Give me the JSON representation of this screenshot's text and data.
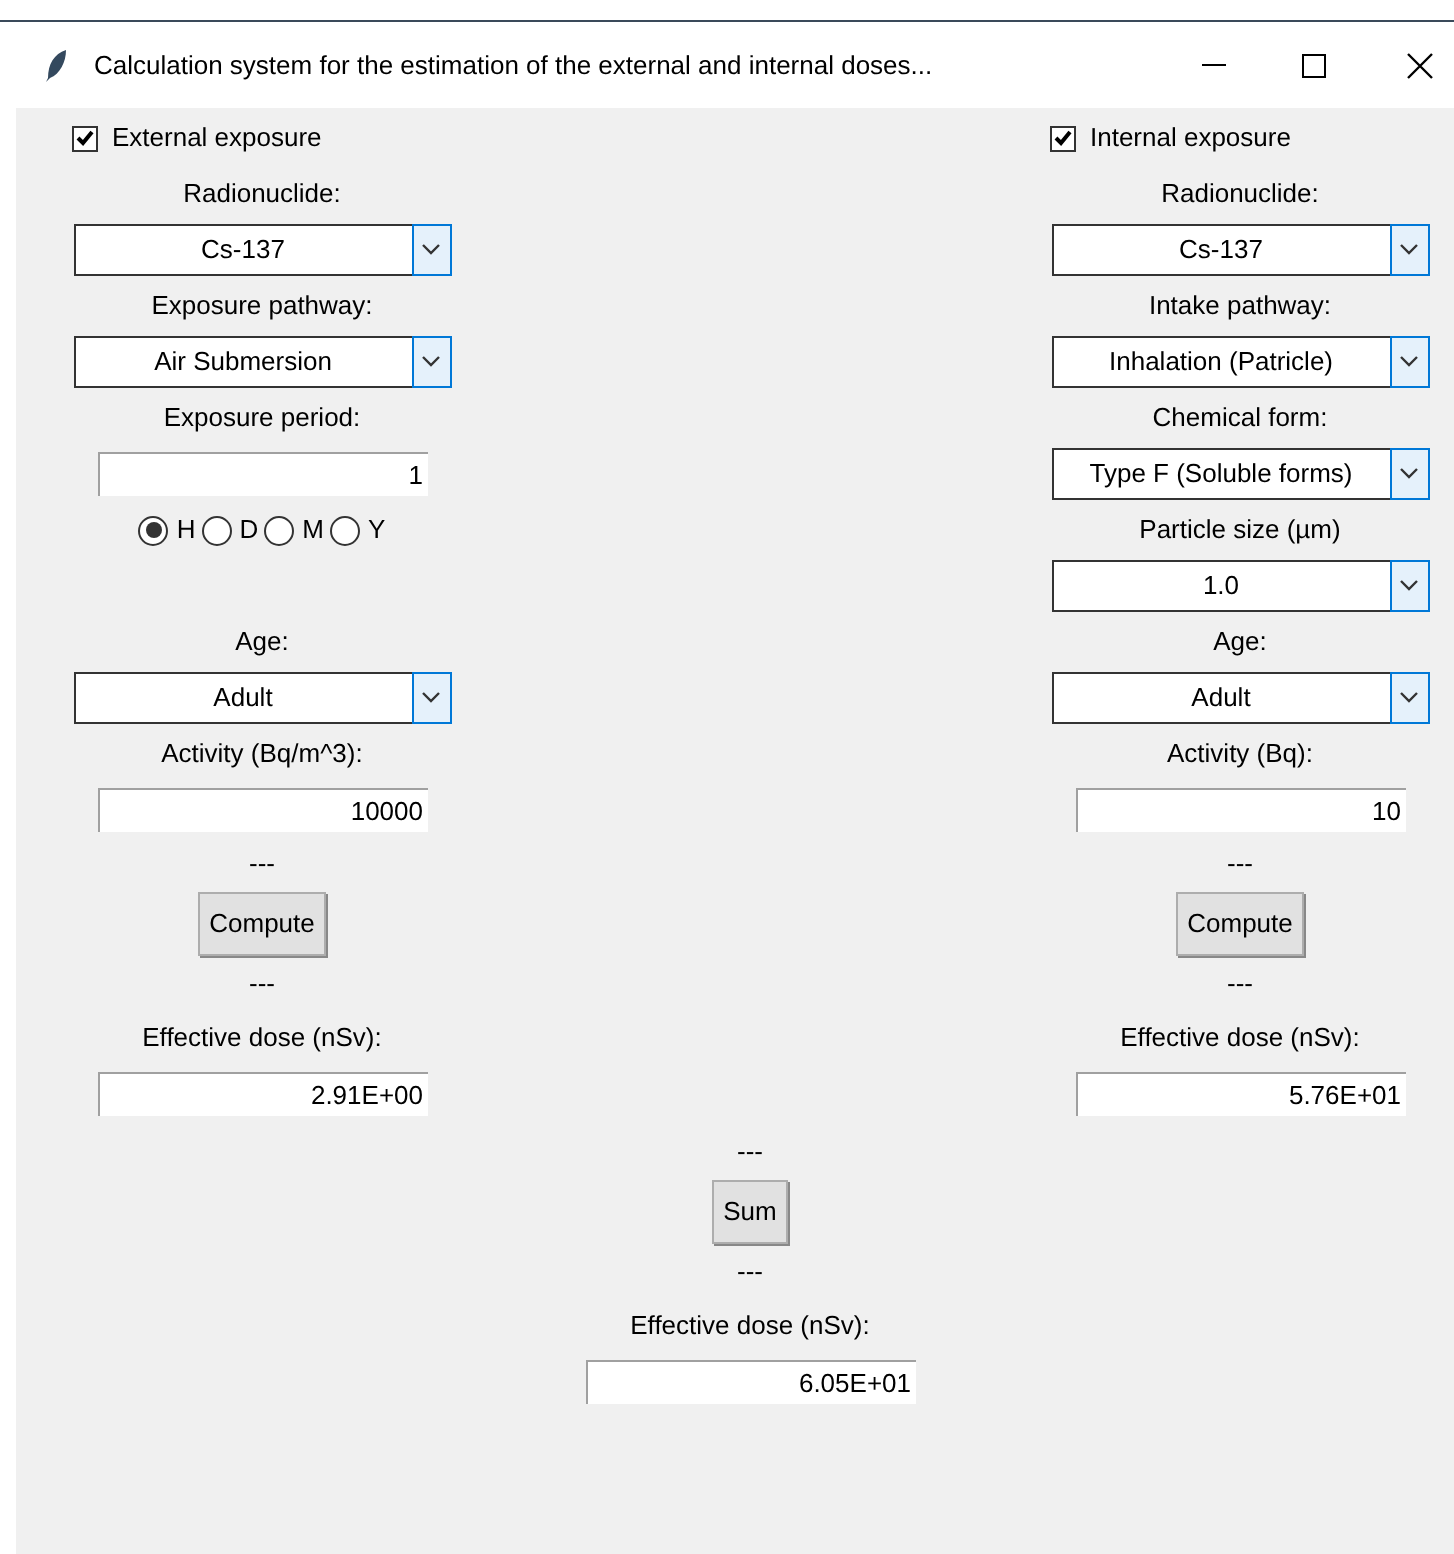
{
  "window": {
    "title": "Calculation system for the estimation of the external and internal doses..."
  },
  "columns": [
    {
      "items": [
        {
          "kind": "checkbox",
          "label": "External exposure",
          "checked": true
        },
        {
          "kind": "label",
          "text": "Radionuclide:"
        },
        {
          "kind": "combo",
          "value": "Cs-137"
        },
        {
          "kind": "label",
          "text": "Exposure pathway:"
        },
        {
          "kind": "combo",
          "value": "Air Submersion"
        },
        {
          "kind": "label",
          "text": "Exposure period:"
        },
        {
          "kind": "entry",
          "value": "1"
        },
        {
          "kind": "radios",
          "options": [
            {
              "label": "H",
              "selected": true
            },
            {
              "label": "D",
              "selected": false
            },
            {
              "label": "M",
              "selected": false
            },
            {
              "label": "Y",
              "selected": false
            }
          ]
        },
        {
          "kind": "label",
          "text": "Age:"
        },
        {
          "kind": "combo",
          "value": "Adult"
        },
        {
          "kind": "label",
          "text": "Activity (Bq/m^3):"
        },
        {
          "kind": "entry",
          "value": "10000"
        },
        {
          "kind": "separator",
          "text": "---"
        },
        {
          "kind": "button",
          "label": "Compute"
        },
        {
          "kind": "separator",
          "text": "---"
        },
        {
          "kind": "label",
          "text": "Effective dose (nSv):"
        },
        {
          "kind": "entry",
          "value": "2.91E+00"
        }
      ]
    },
    {
      "items": [
        {
          "kind": "checkbox",
          "label": "Internal exposure",
          "checked": true
        },
        {
          "kind": "label",
          "text": "Radionuclide:"
        },
        {
          "kind": "combo",
          "value": "Cs-137"
        },
        {
          "kind": "label",
          "text": "Intake pathway:"
        },
        {
          "kind": "combo",
          "value": "Inhalation (Patricle)"
        },
        {
          "kind": "label",
          "text": "Chemical form:"
        },
        {
          "kind": "combo",
          "value": "Type F (Soluble forms)"
        },
        {
          "kind": "label",
          "text": "Particle size (µm)"
        },
        {
          "kind": "combo",
          "value": "1.0"
        },
        {
          "kind": "label",
          "text": "Age:"
        },
        {
          "kind": "combo",
          "value": "Adult"
        },
        {
          "kind": "label",
          "text": "Activity (Bq):"
        },
        {
          "kind": "entry",
          "value": "10"
        },
        {
          "kind": "separator",
          "text": "---"
        },
        {
          "kind": "button",
          "label": "Compute"
        },
        {
          "kind": "separator",
          "text": "---"
        },
        {
          "kind": "label",
          "text": "Effective dose (nSv):"
        },
        {
          "kind": "entry",
          "value": "5.76E+01"
        }
      ]
    }
  ],
  "total": {
    "items": [
      {
        "kind": "separator",
        "text": "---"
      },
      {
        "kind": "button",
        "label": "Sum"
      },
      {
        "kind": "separator",
        "text": "---"
      },
      {
        "kind": "label",
        "text": "Effective dose (nSv):"
      },
      {
        "kind": "entry",
        "value": "6.05E+01"
      }
    ]
  }
}
